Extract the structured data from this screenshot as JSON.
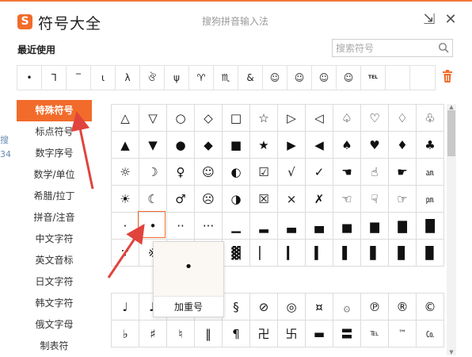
{
  "window": {
    "logo_letter": "S",
    "title": "符号大全",
    "ime_title": "搜狗拼音输入法",
    "pin_symbol": "⇲",
    "close_symbol": "✕"
  },
  "recent": {
    "label": "最近使用",
    "symbols": [
      "•",
      "ᒣ",
      "‾",
      "ι",
      "λ",
      "ঔ",
      "ψ",
      "♈",
      "♏",
      "&",
      "☺",
      "☺",
      "☺",
      "☺",
      "TEL",
      "",
      ""
    ]
  },
  "search": {
    "placeholder": "搜索符号"
  },
  "sidebar": {
    "items": [
      {
        "label": "特殊符号",
        "active": true
      },
      {
        "label": "标点符号"
      },
      {
        "label": "数字序号"
      },
      {
        "label": "数学/单位"
      },
      {
        "label": "希腊/拉丁"
      },
      {
        "label": "拼音/注音"
      },
      {
        "label": "中文字符"
      },
      {
        "label": "英文音标"
      },
      {
        "label": "日文字符"
      },
      {
        "label": "韩文字符"
      },
      {
        "label": "俄文字母"
      },
      {
        "label": "制表符"
      }
    ]
  },
  "left_clip": [
    "搜",
    "34"
  ],
  "grid_top": [
    [
      "△",
      "▽",
      "○",
      "◇",
      "□",
      "☆",
      "▷",
      "◁",
      "♤",
      "♡",
      "♢",
      "♧"
    ],
    [
      "▲",
      "▼",
      "●",
      "◆",
      "■",
      "★",
      "▶",
      "◀",
      "♠",
      "♥",
      "♦",
      "♣"
    ],
    [
      "☼",
      "☽",
      "♀",
      "☺",
      "◐",
      "☑",
      "√",
      "✓",
      "☚",
      "☝",
      "☛",
      "㏂"
    ],
    [
      "☀",
      "☾",
      "♂",
      "☹",
      "◑",
      "☒",
      "×",
      "✗",
      "☜",
      "☟",
      "☞",
      "㏘"
    ],
    [
      "·",
      "•",
      "··",
      "···",
      "▁",
      "▂",
      "▃",
      "▄",
      "▅",
      "▆",
      "▇",
      "█"
    ],
    [
      "∵",
      "※",
      "",
      "",
      "▓",
      "▏",
      "▎",
      "▍",
      "▌",
      "▋",
      "▊",
      "▉"
    ]
  ],
  "grid_bottom": [
    [
      "♩",
      "♪",
      "",
      "",
      "§",
      "⊘",
      "◎",
      "¤",
      "۞",
      "℗",
      "®",
      "©"
    ],
    [
      "♭",
      "♯",
      "♮",
      "‖",
      "¶",
      "卍",
      "卐",
      "▬",
      "〓",
      "℡",
      "™",
      "㏇"
    ]
  ],
  "popup": {
    "symbol": "•",
    "name": "加重号"
  },
  "colors": {
    "accent": "#f26b2a",
    "arrow": "#e0443c"
  }
}
